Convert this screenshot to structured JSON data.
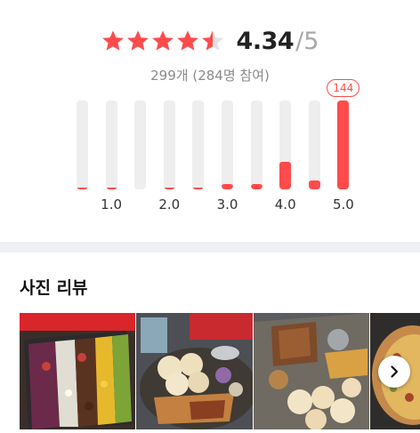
{
  "rating": {
    "score": "4.34",
    "total": "/5",
    "stars": [
      1,
      1,
      1,
      1,
      0.5
    ],
    "count_text": "299개 (284명 참여)",
    "star_color": "#ff4b4b",
    "star_empty_color": "#e1e1e1"
  },
  "chart_data": {
    "type": "bar",
    "categories": [
      "0.5",
      "1.0",
      "1.5",
      "2.0",
      "2.5",
      "3.0",
      "3.5",
      "4.0",
      "4.5",
      "5.0"
    ],
    "values": [
      2,
      2,
      0,
      1,
      1,
      8,
      8,
      44,
      15,
      144
    ],
    "tick_labels": [
      "1.0",
      "2.0",
      "3.0",
      "4.0",
      "5.0"
    ],
    "ylim": [
      0,
      144
    ],
    "peak_label": "144",
    "bar_color": "#ff4b4b",
    "track_color": "#eeeeee"
  },
  "photo_review": {
    "title": "사진 리뷰",
    "photos": [
      {
        "name": "cobb-salad"
      },
      {
        "name": "grill-platter"
      },
      {
        "name": "ribs-platter"
      },
      {
        "name": "pizza"
      }
    ],
    "next_icon": "chevron-right-icon"
  }
}
